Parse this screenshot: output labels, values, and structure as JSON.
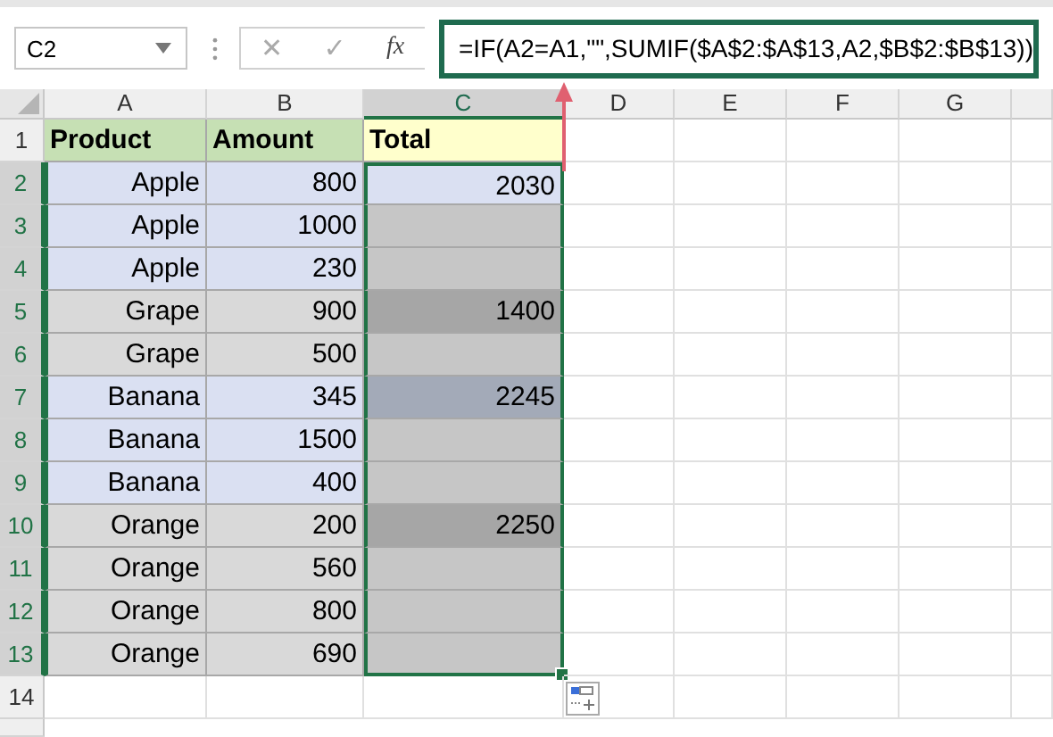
{
  "name_box": {
    "value": "C2"
  },
  "formula_bar": {
    "cancel": "✕",
    "enter": "✓",
    "function": "fx",
    "formula": "=IF(A2=A1,\"\",SUMIF($A$2:$A$13,A2,$B$2:$B$13))"
  },
  "columns": [
    {
      "label": "A",
      "selected": false
    },
    {
      "label": "B",
      "selected": false
    },
    {
      "label": "C",
      "selected": true
    },
    {
      "label": "D",
      "selected": false
    },
    {
      "label": "E",
      "selected": false
    },
    {
      "label": "F",
      "selected": false
    },
    {
      "label": "G",
      "selected": false
    }
  ],
  "header_row": {
    "row": "1",
    "cells": [
      {
        "text": "Product",
        "color": "#c6e0b4"
      },
      {
        "text": "Amount",
        "color": "#c6e0b4"
      },
      {
        "text": "Total",
        "color": "#ffffcc"
      }
    ]
  },
  "rows": [
    {
      "row": "2",
      "selected": true,
      "cells": [
        {
          "text": "Apple",
          "color": "#dae0f2"
        },
        {
          "text": "800",
          "color": "#dae0f2"
        },
        {
          "text": "2030",
          "color": "#dae0f2"
        }
      ]
    },
    {
      "row": "3",
      "selected": true,
      "cells": [
        {
          "text": "Apple",
          "color": "#dae0f2"
        },
        {
          "text": "1000",
          "color": "#dae0f2"
        },
        {
          "color": "#c6c6c6"
        }
      ]
    },
    {
      "row": "4",
      "selected": true,
      "cells": [
        {
          "text": "Apple",
          "color": "#dae0f2"
        },
        {
          "text": "230",
          "color": "#dae0f2"
        },
        {
          "color": "#c6c6c6"
        }
      ]
    },
    {
      "row": "5",
      "selected": true,
      "cells": [
        {
          "text": "Grape",
          "color": "#d9d9d9"
        },
        {
          "text": "900",
          "color": "#d9d9d9"
        },
        {
          "text": "1400",
          "color": "#a6a6a6"
        }
      ]
    },
    {
      "row": "6",
      "selected": true,
      "cells": [
        {
          "text": "Grape",
          "color": "#d9d9d9"
        },
        {
          "text": "500",
          "color": "#d9d9d9"
        },
        {
          "color": "#c6c6c6"
        }
      ]
    },
    {
      "row": "7",
      "selected": true,
      "cells": [
        {
          "text": "Banana",
          "color": "#dae0f2"
        },
        {
          "text": "345",
          "color": "#dae0f2"
        },
        {
          "text": "2245",
          "color": "#a3aab8"
        }
      ]
    },
    {
      "row": "8",
      "selected": true,
      "cells": [
        {
          "text": "Banana",
          "color": "#dae0f2"
        },
        {
          "text": "1500",
          "color": "#dae0f2"
        },
        {
          "color": "#c6c6c6"
        }
      ]
    },
    {
      "row": "9",
      "selected": true,
      "cells": [
        {
          "text": "Banana",
          "color": "#dae0f2"
        },
        {
          "text": "400",
          "color": "#dae0f2"
        },
        {
          "color": "#c6c6c6"
        }
      ]
    },
    {
      "row": "10",
      "selected": true,
      "cells": [
        {
          "text": "Orange",
          "color": "#d9d9d9"
        },
        {
          "text": "200",
          "color": "#d9d9d9"
        },
        {
          "text": "2250",
          "color": "#a6a6a6"
        }
      ]
    },
    {
      "row": "11",
      "selected": true,
      "cells": [
        {
          "text": "Orange",
          "color": "#d9d9d9"
        },
        {
          "text": "560",
          "color": "#d9d9d9"
        },
        {
          "color": "#c6c6c6"
        }
      ]
    },
    {
      "row": "12",
      "selected": true,
      "cells": [
        {
          "text": "Orange",
          "color": "#d9d9d9"
        },
        {
          "text": "800",
          "color": "#d9d9d9"
        },
        {
          "color": "#c6c6c6"
        }
      ]
    },
    {
      "row": "13",
      "selected": true,
      "cells": [
        {
          "text": "Orange",
          "color": "#d9d9d9"
        },
        {
          "text": "690",
          "color": "#d9d9d9"
        },
        {
          "color": "#c6c6c6"
        }
      ]
    }
  ],
  "empty_rows": [
    {
      "row": "14",
      "selected": false
    }
  ]
}
